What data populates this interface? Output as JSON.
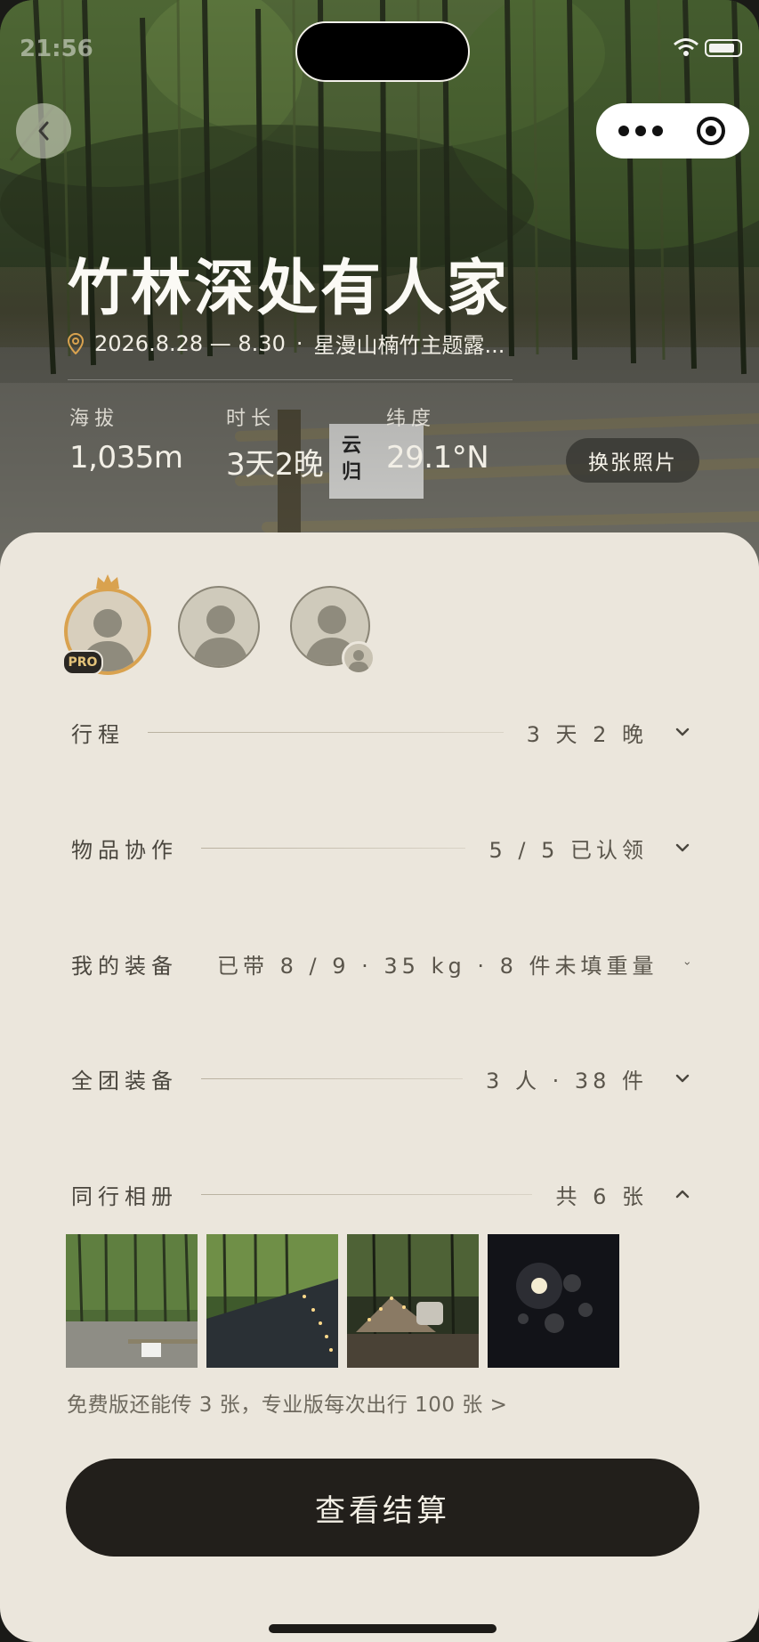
{
  "status_bar": {
    "time": "21:56"
  },
  "hero": {
    "title": "竹林深处有人家",
    "date_range": "2026.8.28 — 8.30",
    "separator": "·",
    "location": "星漫山楠竹主题露...",
    "stats": [
      {
        "label": "海拔",
        "value": "1,035m"
      },
      {
        "label": "时长",
        "value": "3天2晚"
      },
      {
        "label": "纬度",
        "value": "29.1°N"
      }
    ],
    "swap_photo_label": "换张照片",
    "sign_text_1": "云",
    "sign_text_2": "归"
  },
  "members": {
    "owner_badge": "PRO",
    "count": 3
  },
  "sections": [
    {
      "label": "行程",
      "value": "3 天 2 晚",
      "expanded": false
    },
    {
      "label": "物品协作",
      "value": "5 / 5 已认领",
      "expanded": false
    },
    {
      "label": "我的装备",
      "value": "已带 8 / 9 · 35 kg · 8 件未填重量",
      "expanded": false
    },
    {
      "label": "全团装备",
      "value": "3 人 · 38 件",
      "expanded": false
    },
    {
      "label": "同行相册",
      "value": "共 6 张",
      "expanded": true
    }
  ],
  "album": {
    "photos": [
      "bamboo-camp-photo",
      "tent-lights-photo",
      "tent-night-photo",
      "moon-night-photo"
    ],
    "upgrade_text": "免费版还能传 3 张，专业版每次出行 100 张 >"
  },
  "settle_button": "查看结算",
  "icons": {
    "back": "chevron-left-icon",
    "more": "more-dots-icon",
    "close": "target-icon",
    "location": "pin-icon",
    "crown": "crown-icon"
  },
  "colors": {
    "sheet_bg": "#ebe6dc",
    "primary_button": "#221f1b",
    "owner_ring": "#d9a24f"
  }
}
